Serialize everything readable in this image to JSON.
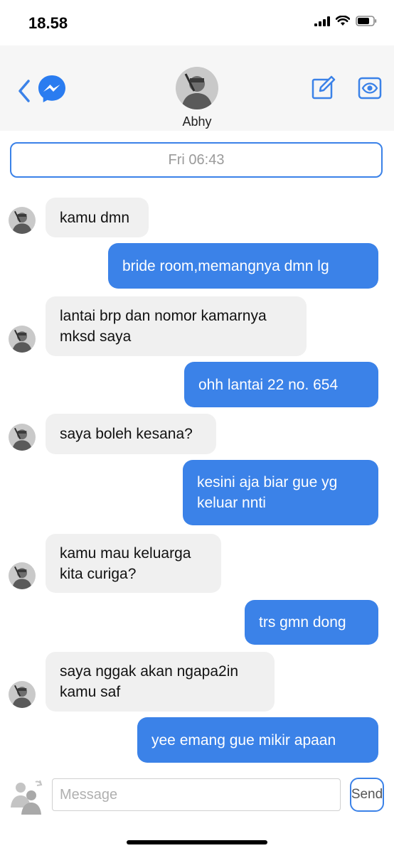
{
  "status_bar": {
    "time": "18.58"
  },
  "header": {
    "contact_name": "Abhy"
  },
  "conversation": {
    "date_label": "Fri 06:43",
    "messages": [
      {
        "direction": "in",
        "lines": [
          "kamu dmn"
        ]
      },
      {
        "direction": "out",
        "lines": [
          "bride room,memangnya dmn lg"
        ]
      },
      {
        "direction": "in",
        "lines": [
          "lantai brp dan nomor kamarnya",
          "mksd saya"
        ]
      },
      {
        "direction": "out",
        "lines": [
          "ohh lantai 22 no. 654"
        ]
      },
      {
        "direction": "in",
        "lines": [
          "saya boleh kesana?"
        ]
      },
      {
        "direction": "out",
        "lines": [
          "kesini aja biar gue yg",
          "keluar nnti"
        ]
      },
      {
        "direction": "in",
        "lines": [
          "kamu mau keluarga",
          "kita curiga?"
        ]
      },
      {
        "direction": "out",
        "lines": [
          "trs gmn dong"
        ]
      },
      {
        "direction": "in",
        "lines": [
          "saya nggak akan ngapa2in",
          "kamu saf"
        ]
      },
      {
        "direction": "out",
        "lines": [
          "yee emang gue mikir apaan"
        ]
      }
    ]
  },
  "composer": {
    "placeholder": "Message",
    "value": "",
    "send_label": "Send"
  },
  "icons": {
    "back": "chevron-left-icon",
    "app": "messenger-icon",
    "compose": "compose-icon",
    "view": "eye-icon",
    "contacts": "people-icon"
  },
  "colors": {
    "accent": "#3b82e8",
    "incoming_bubble": "#f0f0f0",
    "header_bg": "#f6f6f6"
  }
}
